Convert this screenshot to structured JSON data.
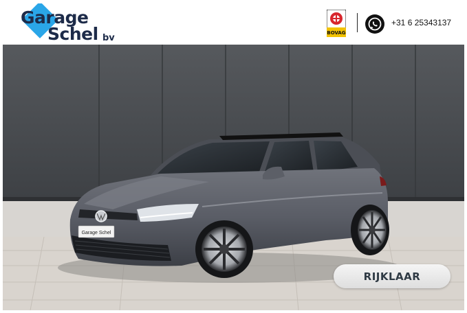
{
  "header": {
    "logo": {
      "line1": "Garage",
      "line2": "Schel",
      "suffix": "bv",
      "accent_color": "#2aa6e8",
      "text_color": "#1d2b49"
    },
    "bovag_badge": {
      "label": "BOVAG",
      "icon": "bovag-logo"
    },
    "whatsapp_icon": "whatsapp-icon",
    "phone": "+31 6 25343137"
  },
  "photo": {
    "plate_text": "Garage Schel"
  },
  "badge": {
    "label": "RIJKLAAR"
  }
}
